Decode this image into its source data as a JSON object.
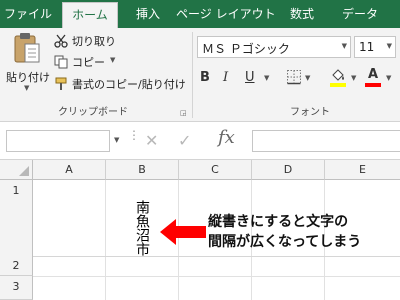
{
  "tabs": [
    "ファイル",
    "ホーム",
    "挿入",
    "ページ レイアウト",
    "数式",
    "データ"
  ],
  "clipboard": {
    "paste_label": "貼り付け",
    "cut_label": "切り取り",
    "copy_label": "コピー",
    "format_painter_label": "書式のコピー/貼り付け",
    "group_label": "クリップボード"
  },
  "font": {
    "name": "ＭＳ Ｐゴシック",
    "size": "11",
    "bold": "B",
    "italic": "I",
    "underline": "U",
    "font_color_letter": "A",
    "group_label": "フォント",
    "highlight_color": "#ffff00",
    "font_color": "#ff0000"
  },
  "formula_bar": {
    "fx_label": "fx",
    "name_box_value": "",
    "content": ""
  },
  "grid": {
    "columns": [
      "A",
      "B",
      "C",
      "D",
      "E"
    ],
    "rows": [
      "1",
      "2",
      "3"
    ],
    "cell_b1": "南魚沼市"
  },
  "annotation": {
    "line1": "縦書きにすると文字の",
    "line2": "間隔が広くなってしまう",
    "arrow_color": "#ff0000"
  },
  "theme": {
    "brand_green": "#217346"
  }
}
